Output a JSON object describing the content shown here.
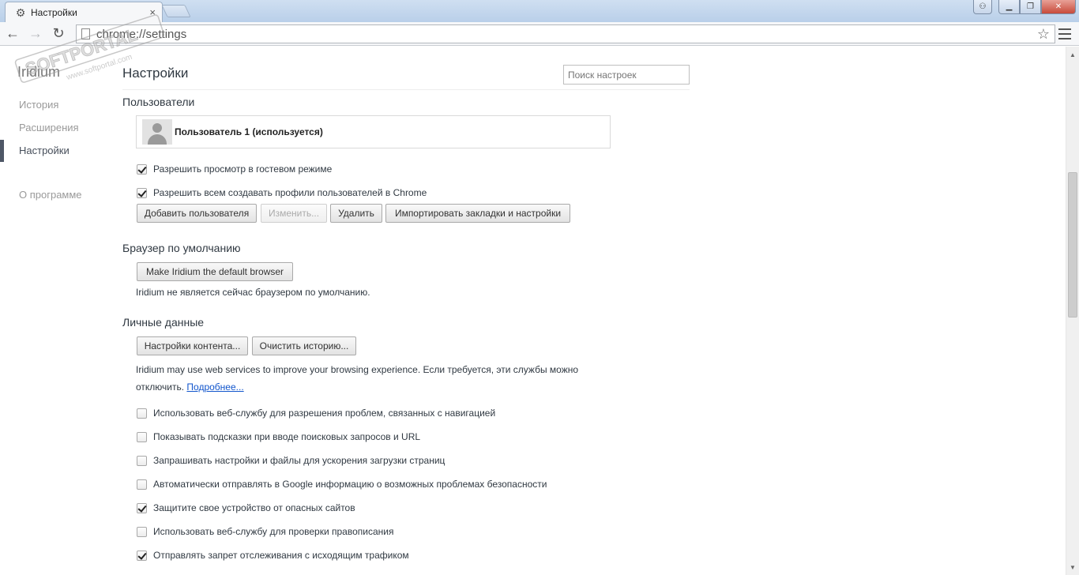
{
  "window": {
    "tab_title": "Настройки",
    "tab_close": "×",
    "controls": {
      "user": "⚇",
      "minimize": "▁",
      "maximize": "❐",
      "close": "✕"
    }
  },
  "toolbar": {
    "back": "←",
    "forward": "→",
    "reload": "↻",
    "url": "chrome://settings",
    "star": "☆"
  },
  "nav": {
    "brand": "Iridium",
    "items": [
      {
        "label": "История",
        "active": false
      },
      {
        "label": "Расширения",
        "active": false
      },
      {
        "label": "Настройки",
        "active": true
      },
      {
        "label": "О программе",
        "active": false
      }
    ]
  },
  "main": {
    "title": "Настройки",
    "search_placeholder": "Поиск настроек",
    "users": {
      "heading": "Пользователи",
      "profile_name": "Пользователь 1 (используется)",
      "checkboxes": [
        {
          "label": "Разрешить просмотр в гостевом режиме",
          "checked": true
        },
        {
          "label": "Разрешить всем создавать профили пользователей в Chrome",
          "checked": true
        }
      ],
      "buttons": {
        "add": "Добавить пользователя",
        "edit": "Изменить...",
        "delete": "Удалить",
        "import": "Импортировать закладки и настройки"
      }
    },
    "default_browser": {
      "heading": "Браузер по умолчанию",
      "button": "Make Iridium the default browser",
      "status": "Iridium не является сейчас браузером по умолчанию."
    },
    "privacy": {
      "heading": "Личные данные",
      "buttons": {
        "content": "Настройки контента...",
        "clear": "Очистить историю..."
      },
      "info_line1": "Iridium may use web services to improve your browsing experience. Если требуется, эти службы можно",
      "info_line2": "отключить.",
      "learn_more": "Подробнее...",
      "checkboxes": [
        {
          "label": "Использовать веб-службу для разрешения проблем, связанных с навигацией",
          "checked": false
        },
        {
          "label": "Показывать подсказки при вводе поисковых запросов и URL",
          "checked": false
        },
        {
          "label": "Запрашивать настройки и файлы для ускорения загрузки страниц",
          "checked": false
        },
        {
          "label": "Автоматически отправлять в Google информацию о возможных проблемах безопасности",
          "checked": false
        },
        {
          "label": "Защитите свое устройство от опасных сайтов",
          "checked": true
        },
        {
          "label": "Использовать веб-службу для проверки правописания",
          "checked": false
        },
        {
          "label": "Отправлять запрет отслеживания с исходящим трафиком",
          "checked": true
        }
      ]
    }
  },
  "watermark": {
    "brand": "SOFTPORTAL",
    "url": "www.softportal.com"
  }
}
